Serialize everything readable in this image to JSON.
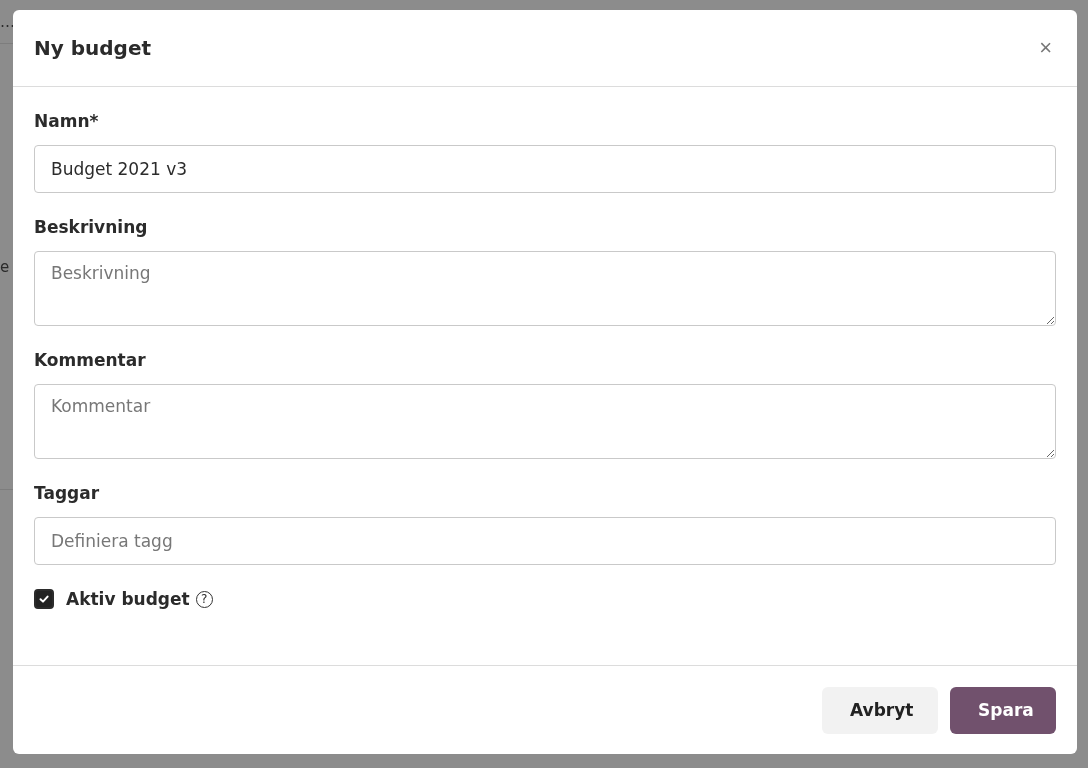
{
  "background": {
    "fragments": [
      {
        "text": "…"
      },
      {
        "text": "e"
      }
    ]
  },
  "dialog": {
    "title": "Ny budget",
    "close": "×",
    "fields": [
      {
        "kind": "input",
        "label": "Namn*",
        "value": "Budget 2021 v3"
      },
      {
        "kind": "textarea",
        "label": "Beskrivning",
        "placeholder": "Beskrivning"
      },
      {
        "kind": "textarea",
        "label": "Kommentar",
        "placeholder": "Kommentar"
      },
      {
        "kind": "input",
        "label": "Taggar",
        "placeholder": "Definiera tagg"
      }
    ],
    "checkbox": {
      "label": "Aktiv budget",
      "checked": true,
      "help": "?"
    },
    "buttons": [
      {
        "label": "Avbryt",
        "kind": "secondary"
      },
      {
        "label": "Spara",
        "kind": "primary"
      }
    ]
  }
}
